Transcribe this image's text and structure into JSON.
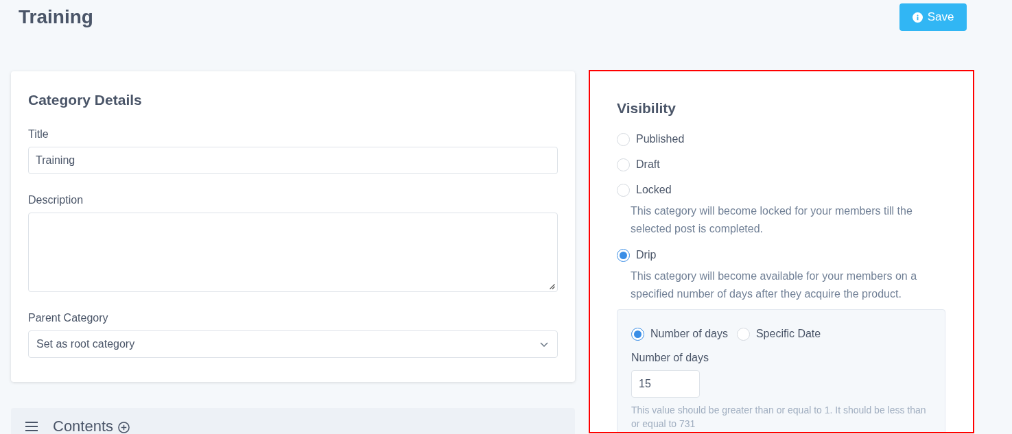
{
  "page": {
    "title": "Training"
  },
  "save_button": {
    "label": "Save"
  },
  "category_details": {
    "heading": "Category Details",
    "fields": [
      {
        "kind": "text",
        "label": "Title",
        "value": "Training"
      },
      {
        "kind": "textarea",
        "label": "Description"
      },
      {
        "kind": "select",
        "label": "Parent Category",
        "value": "Set as root category"
      }
    ]
  },
  "contents": {
    "title": "Contents"
  },
  "visibility": {
    "highlighted": true,
    "heading": "Visibility",
    "options": [
      {
        "label": "Published",
        "selected": false
      },
      {
        "label": "Draft",
        "selected": false
      },
      {
        "label": "Locked",
        "selected": false,
        "description": "This category will become locked for your members till the selected post is completed."
      },
      {
        "label": "Drip",
        "selected": true,
        "description": "This category will become available for your members on a specified number of days after they acquire the product.",
        "settings": {
          "modes": [
            {
              "label": "Number of days",
              "selected": true
            },
            {
              "label": "Specific Date",
              "selected": false
            }
          ],
          "field": {
            "label": "Number of days",
            "value": "15",
            "hint": "This value should be greater than or equal to 1. It should be less than or equal to 731"
          }
        }
      }
    ]
  }
}
